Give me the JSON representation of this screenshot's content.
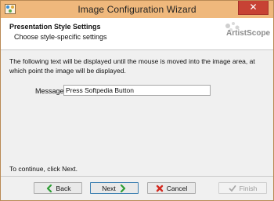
{
  "window": {
    "title": "Image Configuration Wizard",
    "close_glyph": "✕"
  },
  "header": {
    "title": "Presentation Style Settings",
    "subtitle": "Choose style-specific settings",
    "logo_text": "ArtistScope"
  },
  "content": {
    "description": "The following text will be displayed until the mouse is moved into the image area, at which point the image will be displayed.",
    "message_label": "Message:",
    "message_value": "Press Softpedia Button",
    "continue_text": "To continue, click Next."
  },
  "footer": {
    "back_label": "Back",
    "next_label": "Next",
    "cancel_label": "Cancel",
    "finish_label": "Finish"
  },
  "colors": {
    "titlebar": "#efb87c",
    "close": "#c74234",
    "arrow_green": "#2e9e35",
    "cancel_red": "#d42a20"
  },
  "icons": {
    "back": "back-arrow-icon",
    "next": "next-arrow-icon",
    "cancel": "cancel-x-icon",
    "finish": "finish-check-icon"
  }
}
